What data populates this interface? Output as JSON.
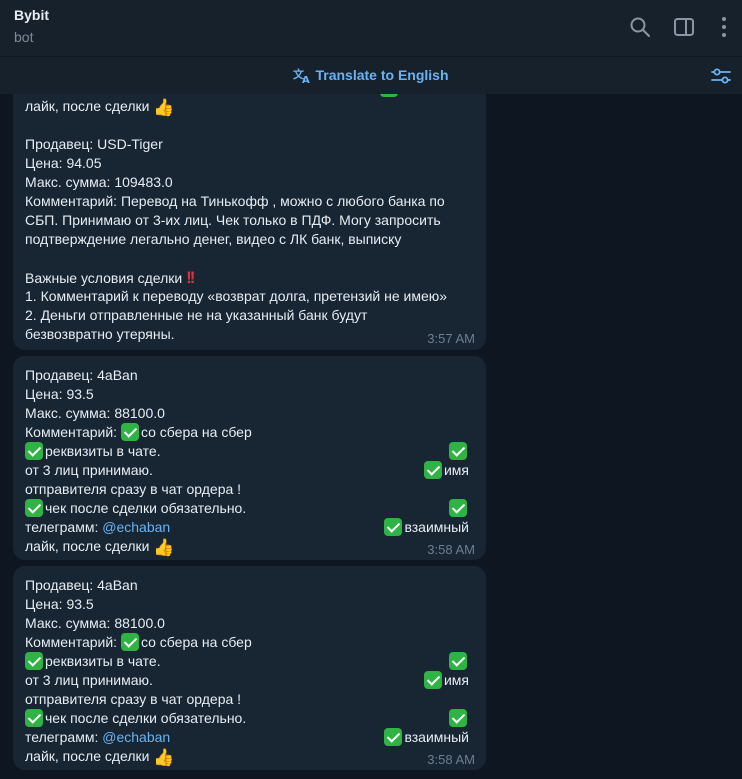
{
  "header": {
    "title": "Bybit",
    "subtitle": "bot",
    "icons": [
      "search-icon",
      "sidebar-toggle-icon",
      "more-vertical-icon"
    ]
  },
  "translate_bar": {
    "label": "Translate to English",
    "icon": "translate-icon",
    "settings_icon": "filter-settings-icon"
  },
  "colors": {
    "background": "#0e1621",
    "bubble": "#182533",
    "accent": "#6ab3f3",
    "check": "#2fb344"
  },
  "messages": [
    {
      "partial_top": "лайк, после сделки",
      "seller": "Продавец: USD-Tiger",
      "price": "Цена: 94.05",
      "max_sum": "Макс. сумма: 109483.0",
      "comment_lines": [
        "Комментарий: Перевод на Тинькофф , можно с любого банка по",
        "СБП. Принимаю от 3-их лиц. Чек только в ПДФ. Могу запросить",
        "подтверждение легально денег, видео с ЛК банк, выписку"
      ],
      "conditions_title": "Важные условия сделки",
      "conditions_lines": [
        "1. Комментарий к переводу «возврат долга, претензий не имею»",
        "2. Деньги отправленные не на указанный банк будут",
        "безвозвратно утеряны."
      ],
      "time": "3:57 AM"
    },
    {
      "seller": "Продавец: 4aBan",
      "price": "Цена: 93.5",
      "max_sum": "Макс. сумма: 88100.0",
      "comment_prefix": "Комментарий: ",
      "comment_a": "со сбера на сбер",
      "req": "реквизиты в чате.",
      "from3": "от 3 лиц принимаю.",
      "name": "имя",
      "sender": "отправителя сразу в чат ордера !",
      "check_after": "чек после сделки обязательно.",
      "telegram_prefix": "телеграмм: ",
      "handle": "@echaban",
      "mutual": "взаимный",
      "like": "лайк, после сделки",
      "time": "3:58 AM"
    },
    {
      "seller": "Продавец: 4aBan",
      "price": "Цена: 93.5",
      "max_sum": "Макс. сумма: 88100.0",
      "comment_prefix": "Комментарий: ",
      "comment_a": "со сбера на сбер",
      "req": "реквизиты в чате.",
      "from3": "от 3 лиц принимаю.",
      "name": "имя",
      "sender": "отправителя сразу в чат ордера !",
      "check_after": "чек после сделки обязательно.",
      "telegram_prefix": "телеграмм: ",
      "handle": "@echaban",
      "mutual": "взаимный",
      "like": "лайк, после сделки",
      "time": "3:58 AM"
    }
  ]
}
